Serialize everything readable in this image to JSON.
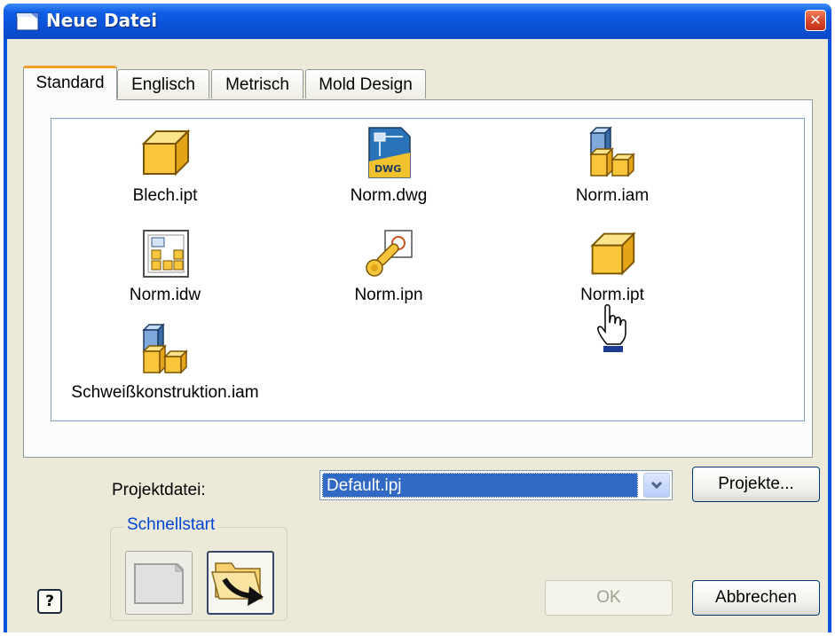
{
  "window": {
    "title": "Neue Datei"
  },
  "tabs": [
    {
      "label": "Standard"
    },
    {
      "label": "Englisch"
    },
    {
      "label": "Metrisch"
    },
    {
      "label": "Mold Design"
    }
  ],
  "files": [
    {
      "name": "Blech.ipt",
      "icon": "part-cube-icon"
    },
    {
      "name": "Norm.dwg",
      "icon": "dwg-file-icon",
      "badge": "DWG"
    },
    {
      "name": "Norm.iam",
      "icon": "assembly-icon"
    },
    {
      "name": "Norm.idw",
      "icon": "drawing-sheet-icon"
    },
    {
      "name": "Norm.ipn",
      "icon": "presentation-icon"
    },
    {
      "name": "Norm.ipt",
      "icon": "part-cube-icon"
    },
    {
      "name": "Schweißkonstruktion.iam",
      "icon": "assembly-icon"
    }
  ],
  "project": {
    "label": "Projektdatei:",
    "value": "Default.ipj",
    "button": "Projekte..."
  },
  "quickstart": {
    "label": "Schnellstart"
  },
  "buttons": {
    "ok": "OK",
    "cancel": "Abbrechen"
  },
  "colors": {
    "title_bar": "#0a55dc",
    "selection": "#316ac5",
    "dialog_bg": "#ece9d8",
    "cube_yellow": "#f9c63b"
  }
}
